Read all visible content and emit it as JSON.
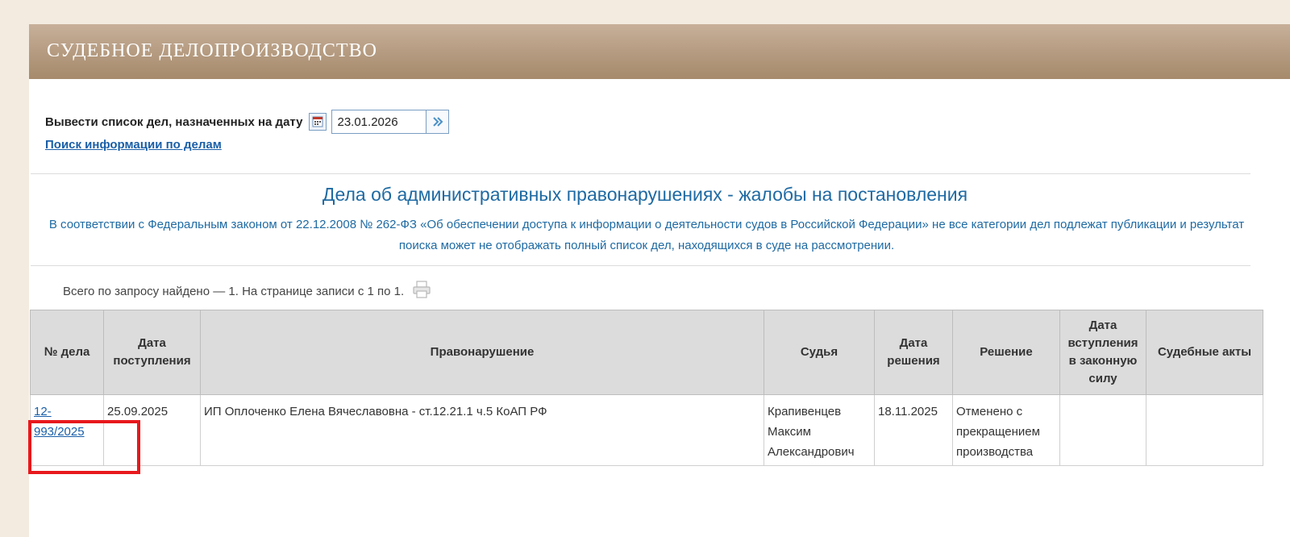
{
  "header": {
    "title": "СУДЕБНОЕ ДЕЛОПРОИЗВОДСТВО"
  },
  "date_filter": {
    "label": "Вывести список дел, назначенных на дату",
    "date_value": "23.01.2026",
    "calendar_icon": "calendar-icon",
    "go_icon": "double-chevron-right-icon"
  },
  "search_link": "Поиск информации по делам",
  "section_title": "Дела об административных правонарушениях - жалобы на постановления",
  "notice": "В соответствии с Федеральным законом от 22.12.2008 № 262-ФЗ «Об обеспечении доступа к информации о деятельности судов в Российской Федерации» не все категории дел подлежат публикации и результат поиска может не отображать полный список дел, находящихся в суде на рассмотрении.",
  "result_count": "Всего по запросу найдено — 1. На странице записи с 1 по 1.",
  "table": {
    "headers": {
      "case_no": "№ дела",
      "received": "Дата поступления",
      "offense": "Правонарушение",
      "judge": "Судья",
      "decision_date": "Дата решения",
      "decision": "Решение",
      "effective_date": "Дата вступления в законную силу",
      "acts": "Судебные акты"
    },
    "rows": [
      {
        "case_no_line1": "12-",
        "case_no_line2": "993/2025",
        "received": "25.09.2025",
        "offense": "ИП Оплоченко Елена Вячеславовна - ст.12.21.1 ч.5 КоАП РФ",
        "judge_line1": "Крапивенцев",
        "judge_line2": "Максим",
        "judge_line3": "Александрович",
        "decision_date": "18.11.2025",
        "decision_line1": "Отменено с",
        "decision_line2": "прекращением",
        "decision_line3": "производства",
        "effective_date": "",
        "acts": ""
      }
    ]
  },
  "colors": {
    "header_bar": "#b49a7f",
    "link": "#1a5fa8",
    "title_blue": "#1e6aa3",
    "highlight": "#e8181c"
  }
}
